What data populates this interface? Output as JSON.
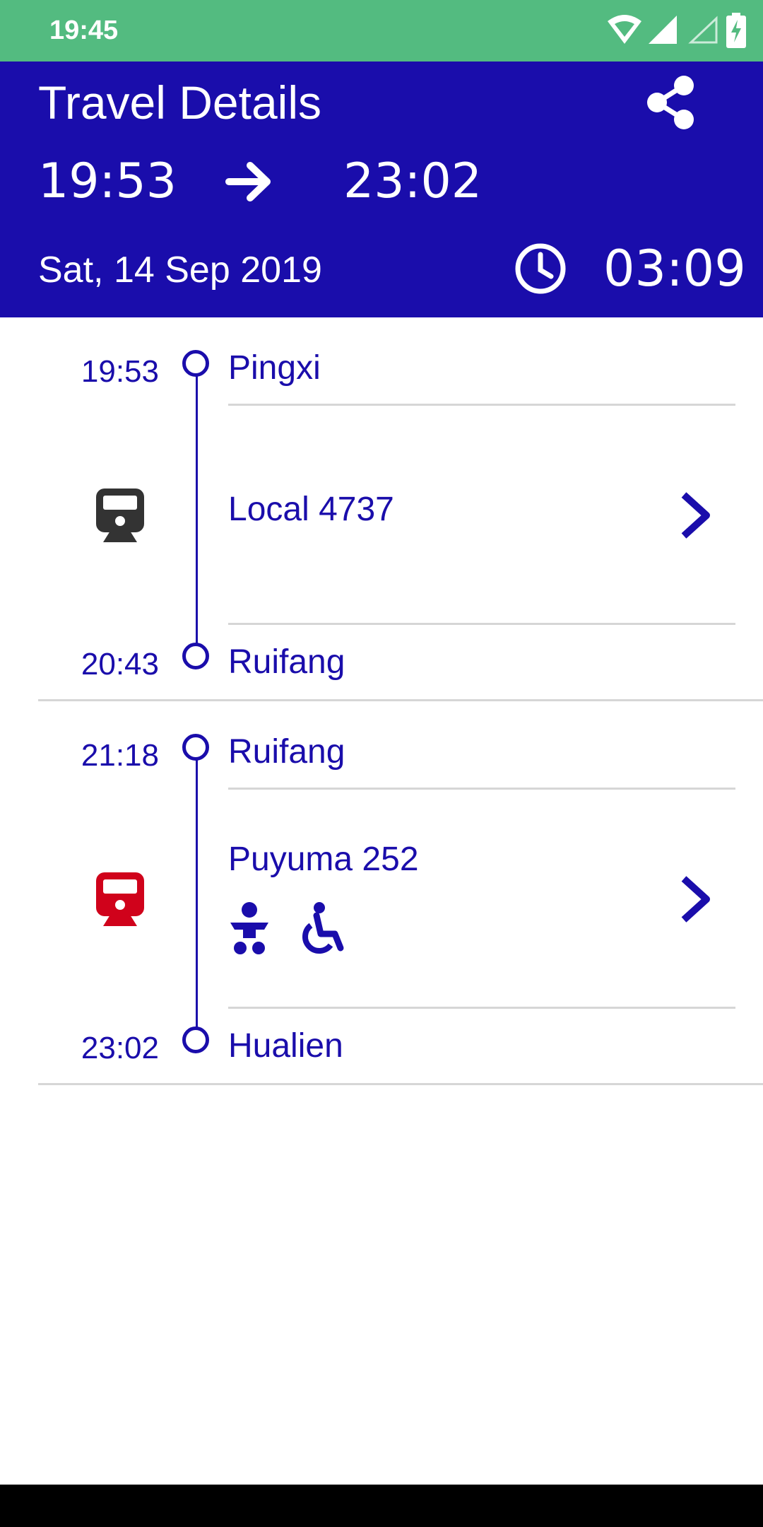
{
  "status_bar": {
    "time": "19:45",
    "icons": [
      "wifi-icon",
      "signal-icon",
      "signal-empty-icon",
      "battery-charging-icon"
    ]
  },
  "header": {
    "title": "Travel Details",
    "share_icon": "share-icon",
    "departure_time": "19:53",
    "arrow_icon": "arrow-right-icon",
    "arrival_time": "23:02",
    "date": "Sat, 14 Sep 2019",
    "clock_icon": "clock-icon",
    "duration": "03:09"
  },
  "colors": {
    "status_bar": "#53bb80",
    "app_bar": "#1a0dab",
    "accent": "#1a0dab",
    "local_train": "#333333",
    "express_train": "#d0021b",
    "divider": "#d6d6d6"
  },
  "legs": [
    {
      "depart_time": "19:53",
      "depart_station": "Pingxi",
      "train_name": "Local 4737",
      "train_icon": "train-icon",
      "train_color": "#333333",
      "amenities": [],
      "arrive_time": "20:43",
      "arrive_station": "Ruifang"
    },
    {
      "depart_time": "21:18",
      "depart_station": "Ruifang",
      "train_name": "Puyuma 252",
      "train_icon": "train-icon",
      "train_color": "#d0021b",
      "amenities": [
        "baby-changing-icon",
        "wheelchair-accessible-icon"
      ],
      "arrive_time": "23:02",
      "arrive_station": "Hualien"
    }
  ]
}
